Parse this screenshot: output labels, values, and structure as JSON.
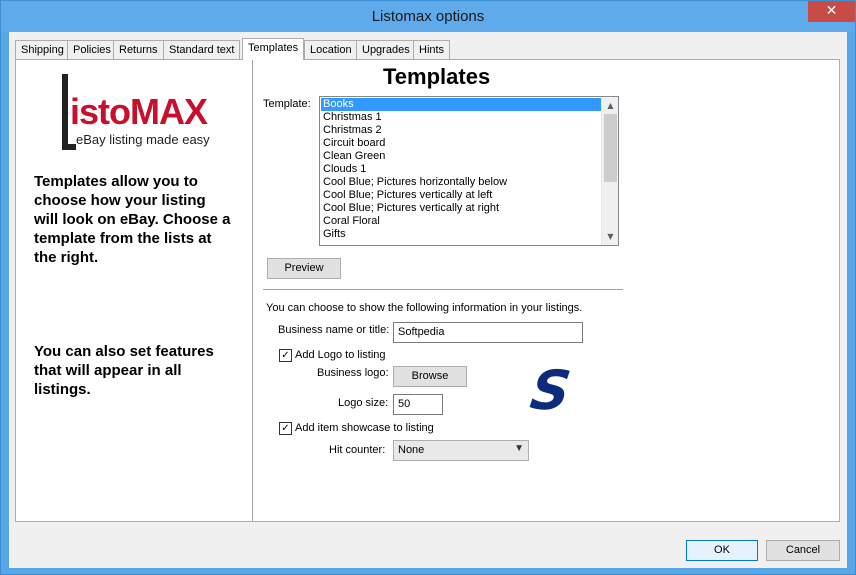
{
  "window": {
    "title": "Listomax options",
    "close_glyph": "✕"
  },
  "tabs": [
    {
      "label": "Shipping"
    },
    {
      "label": "Policies"
    },
    {
      "label": "Returns"
    },
    {
      "label": "Standard text"
    },
    {
      "label": "Templates"
    },
    {
      "label": "Location"
    },
    {
      "label": "Upgrades"
    },
    {
      "label": "Hints"
    }
  ],
  "active_tab": "Templates",
  "left": {
    "logo_word": "istoMAX",
    "logo_tagline": "eBay listing made easy",
    "intro": "Templates allow you to choose how your listing will look on eBay. Choose a template from the lists at the right.",
    "features": "You can also set features that will appear in all listings."
  },
  "right": {
    "heading": "Templates",
    "template_label": "Template:",
    "templates": [
      "Books",
      "Christmas 1",
      "Christmas 2",
      "Circuit board",
      "Clean Green",
      "Clouds 1",
      "Cool Blue; Pictures horizontally below",
      "Cool Blue; Pictures vertically at left",
      "Cool Blue; Pictures vertically at right",
      "Coral Floral",
      "Gifts"
    ],
    "selected_template": "Books",
    "preview_label": "Preview",
    "info_text": "You can choose to show the following information in your listings.",
    "business_name_label": "Business name or title:",
    "business_name_value": "Softpedia",
    "add_logo_label": "Add Logo to listing",
    "add_logo_checked": true,
    "business_logo_label": "Business logo:",
    "browse_label": "Browse",
    "logo_size_label": "Logo size:",
    "logo_size_value": "50",
    "add_showcase_label": "Add item showcase to listing",
    "add_showcase_checked": true,
    "hit_counter_label": "Hit counter:",
    "hit_counter_value": "None",
    "logo_preview_letter": "S"
  },
  "footer": {
    "ok_label": "OK",
    "cancel_label": "Cancel"
  },
  "colors": {
    "titlebar": "#5eaaea",
    "close": "#c74c46",
    "selection": "#3399ff",
    "logo_red": "#c8102e",
    "s_logo": "#0e2a7a"
  }
}
